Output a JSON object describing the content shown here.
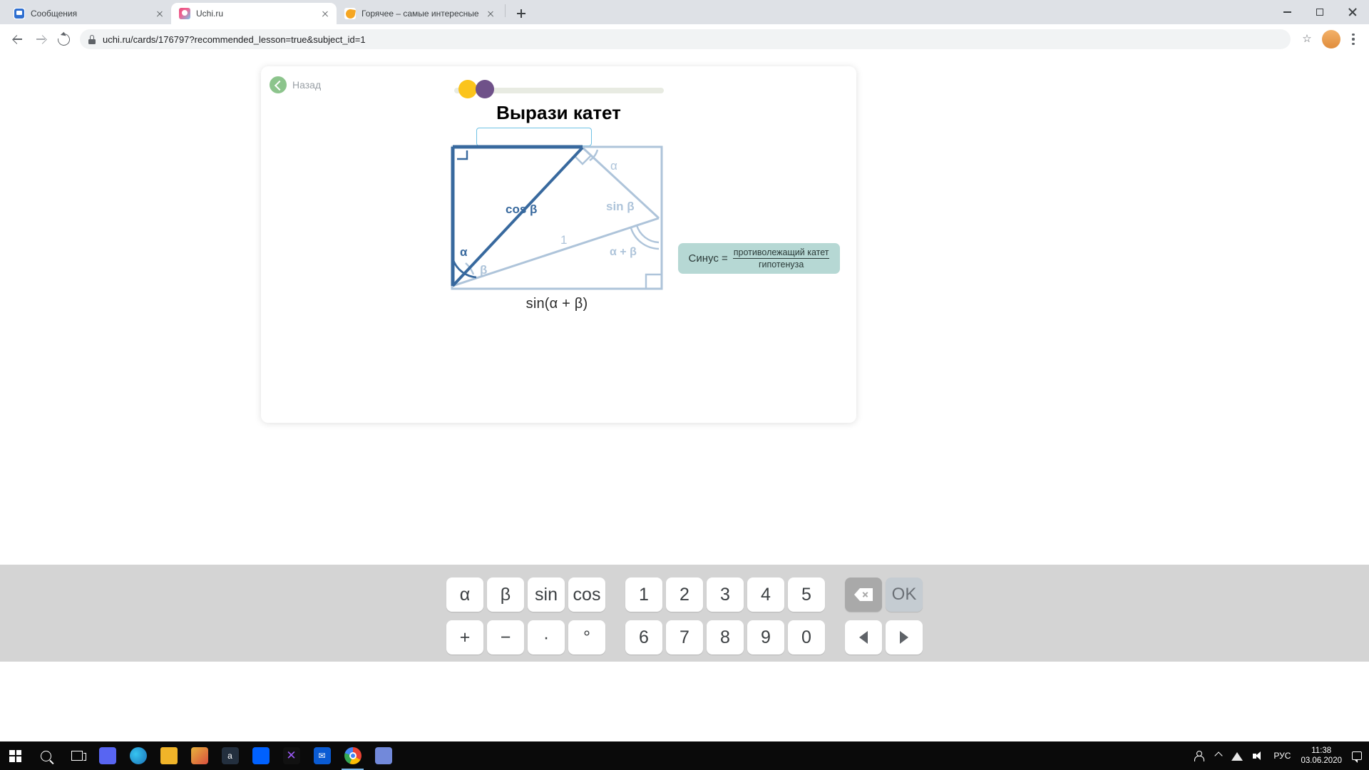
{
  "browser": {
    "tabs": [
      {
        "title": "Сообщения",
        "favicon": "messages-icon",
        "active": false
      },
      {
        "title": "Uchi.ru",
        "favicon": "uchiru-icon",
        "active": true
      },
      {
        "title": "Горячее – самые интересные и",
        "favicon": "pikabu-icon",
        "active": false
      }
    ],
    "newtab_label": "+",
    "url": "uchi.ru/cards/176797?recommended_lesson=true&subject_id=1",
    "window_controls": {
      "minimize": "minimize-icon",
      "maximize": "maximize-icon",
      "close": "close-icon"
    }
  },
  "card": {
    "back_label": "Назад",
    "title": "Вырази катет",
    "answer_value": "",
    "answer_placeholder": "",
    "progress": {
      "dots": [
        "#fbc41c",
        "#6f5189"
      ],
      "track_color": "#e8ebe2"
    },
    "caption": "sin(α + β)",
    "hint": {
      "label": "Синус =",
      "numerator": "противолежащий катет",
      "denominator": "гипотенуза",
      "bg": "#b6d8d4"
    },
    "figure": {
      "labels": {
        "cos_beta": "cos β",
        "sin_beta": "sin β",
        "one": "1",
        "alpha_top": "α",
        "alpha_bottom": "α",
        "beta_bottom": "β",
        "alpha_plus_beta": "α + β"
      },
      "colors": {
        "dark": "#38699e",
        "light": "#aec4da"
      }
    }
  },
  "keyboard": {
    "row1": [
      "α",
      "β",
      "sin",
      "cos",
      "1",
      "2",
      "3",
      "4",
      "5"
    ],
    "row2": [
      "+",
      "−",
      "·",
      "°",
      "6",
      "7",
      "8",
      "9",
      "0"
    ],
    "backspace": "backspace-icon",
    "ok_label": "OK",
    "arrow_left": "arrow-left-icon",
    "arrow_right": "arrow-right-icon"
  },
  "taskbar": {
    "language": "РУС",
    "time": "11:38",
    "date": "03.06.2020"
  }
}
